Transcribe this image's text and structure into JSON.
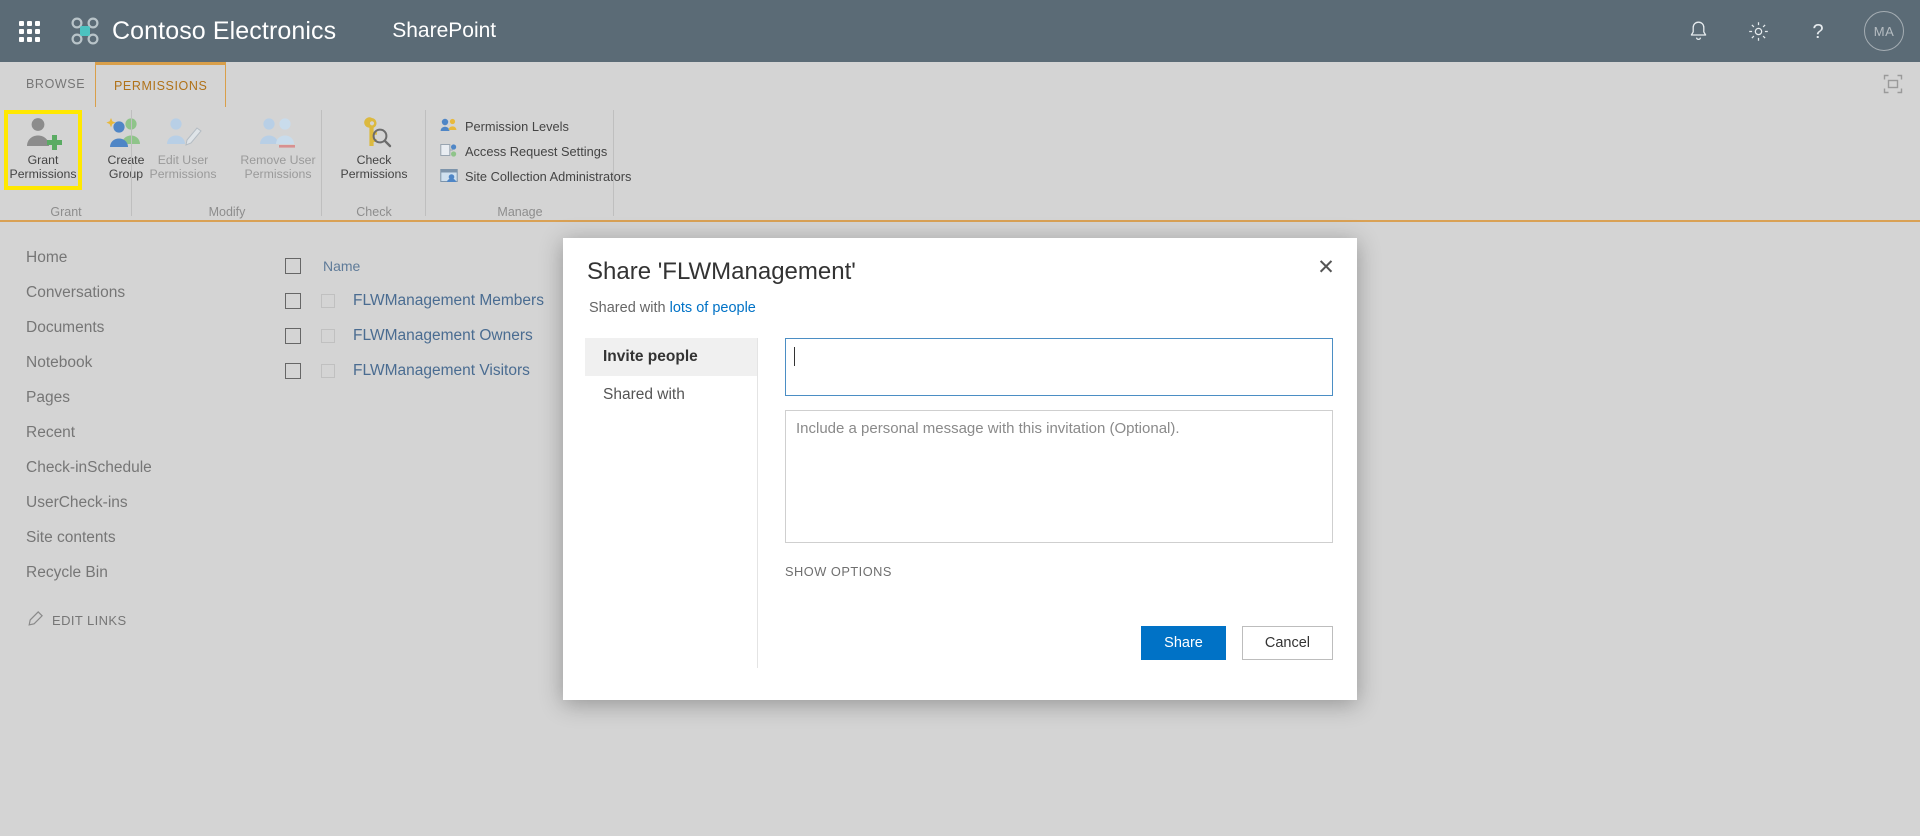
{
  "suite": {
    "waffle_label": "App launcher",
    "brand": "Contoso Electronics",
    "app": "SharePoint",
    "notifications_label": "Notifications",
    "settings_label": "Settings",
    "help_label": "Help",
    "avatar_initials": "MA"
  },
  "ribbon": {
    "tabs": [
      {
        "label": "BROWSE",
        "active": false
      },
      {
        "label": "PERMISSIONS",
        "active": true
      }
    ],
    "focus_label": "Focus on Content",
    "groups": [
      {
        "name": "Grant",
        "buttons": [
          {
            "label_line1": "Grant",
            "label_line2": "Permissions",
            "enabled": true,
            "highlighted": true
          },
          {
            "label_line1": "Create",
            "label_line2": "Group",
            "enabled": true,
            "highlighted": false
          }
        ]
      },
      {
        "name": "Modify",
        "buttons": [
          {
            "label_line1": "Edit User",
            "label_line2": "Permissions",
            "enabled": false,
            "highlighted": false
          },
          {
            "label_line1": "Remove User",
            "label_line2": "Permissions",
            "enabled": false,
            "highlighted": false
          }
        ]
      },
      {
        "name": "Check",
        "buttons": [
          {
            "label_line1": "Check",
            "label_line2": "Permissions",
            "enabled": true,
            "highlighted": false
          }
        ]
      },
      {
        "name": "Manage",
        "items": [
          {
            "label": "Permission Levels",
            "icon": "permission-levels-icon"
          },
          {
            "label": "Access Request Settings",
            "icon": "access-request-icon"
          },
          {
            "label": "Site Collection Administrators",
            "icon": "site-collection-admins-icon"
          }
        ]
      }
    ]
  },
  "leftnav": {
    "items": [
      {
        "label": "Home"
      },
      {
        "label": "Conversations"
      },
      {
        "label": "Documents"
      },
      {
        "label": "Notebook"
      },
      {
        "label": "Pages"
      },
      {
        "label": "Recent"
      },
      {
        "label": "Check-inSchedule"
      },
      {
        "label": "UserCheck-ins"
      },
      {
        "label": "Site contents"
      },
      {
        "label": "Recycle Bin"
      }
    ],
    "edit_links": "EDIT LINKS"
  },
  "list": {
    "header": {
      "name_column": "Name"
    },
    "rows": [
      {
        "name": "FLWManagement Members"
      },
      {
        "name": "FLWManagement Owners"
      },
      {
        "name": "FLWManagement Visitors"
      }
    ]
  },
  "dialog": {
    "title": "Share 'FLWManagement'",
    "close_label": "✕",
    "shared_with_prefix": "Shared with",
    "shared_with_link": "lots of people",
    "tabs": [
      {
        "label": "Invite people",
        "active": true
      },
      {
        "label": "Shared with",
        "active": false
      }
    ],
    "invite_value": "",
    "invite_placeholder": "",
    "message_value": "",
    "message_placeholder": "Include a personal message with this invitation (Optional).",
    "show_options": "SHOW OPTIONS",
    "share_button": "Share",
    "cancel_button": "Cancel"
  },
  "colors": {
    "suitebar_bg": "#5b6b76",
    "page_bg": "#d4d4d4",
    "ribbon_accent": "#d9a155",
    "highlight": "#ffe800",
    "link": "#4a6c91",
    "primary_button": "#0072c6",
    "brand_accent": "#4cc2c0"
  }
}
